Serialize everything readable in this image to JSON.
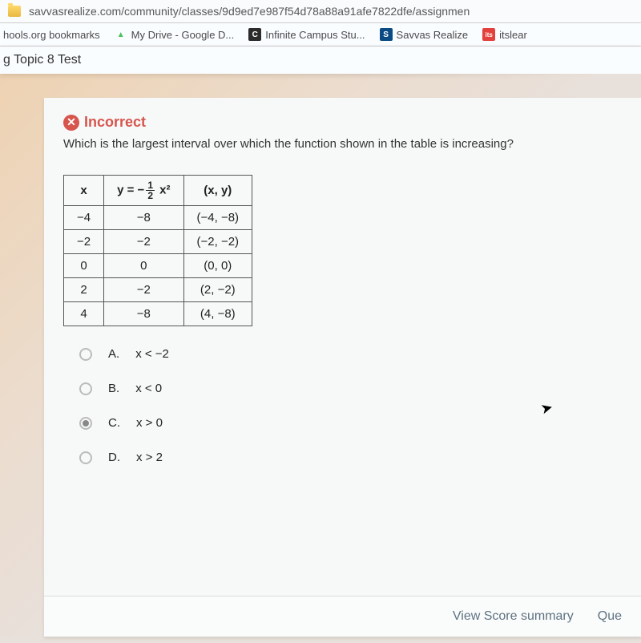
{
  "url": "savvasrealize.com/community/classes/9d9ed7e987f54d78a88a91afe7822dfe/assignmen",
  "bookmarks": [
    {
      "label": "hools.org bookmarks",
      "icon_bg": "",
      "icon_text": ""
    },
    {
      "label": "My Drive - Google D...",
      "icon_bg": "#4dc05a",
      "icon_text": "△"
    },
    {
      "label": "Infinite Campus Stu...",
      "icon_bg": "#2b2b2b",
      "icon_text": "C"
    },
    {
      "label": "Savvas Realize",
      "icon_bg": "#0b4b83",
      "icon_text": "S"
    },
    {
      "label": "itslear",
      "icon_bg": "#e3413d",
      "icon_text": "its"
    }
  ],
  "tab_title": "g Topic 8 Test",
  "status": {
    "text": "Incorrect",
    "icon": "✕"
  },
  "question": "Which is the largest interval over which the function shown in the table is increasing?",
  "table": {
    "headers": {
      "col1": "x",
      "col2_prefix": "y = −",
      "col2_frac_num": "1",
      "col2_frac_den": "2",
      "col2_suffix": " x²",
      "col3": "(x, y)"
    },
    "rows": [
      {
        "x": "−4",
        "y": "−8",
        "xy": "(−4, −8)"
      },
      {
        "x": "−2",
        "y": "−2",
        "xy": "(−2, −2)"
      },
      {
        "x": "0",
        "y": "0",
        "xy": "(0, 0)"
      },
      {
        "x": "2",
        "y": "−2",
        "xy": "(2, −2)"
      },
      {
        "x": "4",
        "y": "−8",
        "xy": "(4, −8)"
      }
    ]
  },
  "answers": [
    {
      "letter": "A.",
      "text": "x < −2",
      "selected": false
    },
    {
      "letter": "B.",
      "text": "x < 0",
      "selected": false
    },
    {
      "letter": "C.",
      "text": "x > 0",
      "selected": true
    },
    {
      "letter": "D.",
      "text": "x > 2",
      "selected": false
    }
  ],
  "footer": {
    "view_score": "View Score summary",
    "que": "Que"
  }
}
